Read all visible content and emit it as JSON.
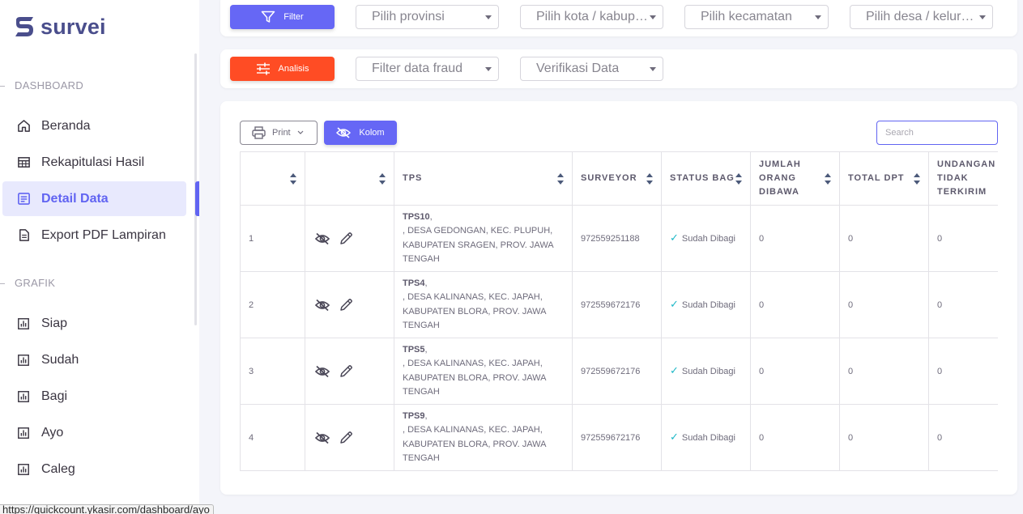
{
  "brand": {
    "name": "survei",
    "color": "#4a4e8c"
  },
  "accent": "#6164f2",
  "sidebar": {
    "sections": [
      {
        "title": "DASHBOARD"
      },
      {
        "title": "GRAFIK"
      }
    ],
    "items": [
      {
        "label": "Beranda",
        "icon": "home-icon"
      },
      {
        "label": "Rekapitulasi Hasil",
        "icon": "table-grid-icon"
      },
      {
        "label": "Detail Data",
        "icon": "document-list-icon",
        "active": true
      },
      {
        "label": "Export PDF Lampiran",
        "icon": "file-icon"
      },
      {
        "label": "Siap",
        "icon": "bar-chart-icon"
      },
      {
        "label": "Sudah",
        "icon": "bar-chart-icon"
      },
      {
        "label": "Bagi",
        "icon": "bar-chart-icon"
      },
      {
        "label": "Ayo",
        "icon": "bar-chart-icon"
      },
      {
        "label": "Caleg",
        "icon": "bar-chart-icon"
      }
    ]
  },
  "filters": {
    "filter_button": "Filter",
    "provinsi": "Pilih provinsi",
    "kota": "Pilih kota / kabupaten",
    "kecamatan": "Pilih kecamatan",
    "desa": "Pilih desa / kelurahan"
  },
  "analisis": {
    "button": "Analisis",
    "fraud": "Filter data fraud",
    "verifikasi": "Verifikasi Data"
  },
  "toolbar": {
    "print": "Print",
    "kolom": "Kolom",
    "search_placeholder": "Search"
  },
  "table": {
    "columns": [
      "",
      "",
      "TPS",
      "SURVEYOR",
      "STATUS BAGI",
      "JUMLAH ORANG DIBAWA",
      "TOTAL DPT",
      "UNDANGAN TIDAK TERKIRIM"
    ],
    "rows": [
      {
        "no": "1",
        "tps": "TPS10",
        "address": ", DESA GEDONGAN, KEC. PLUPUH, KABUPATEN SRAGEN, PROV. JAWA TENGAH",
        "surveyor": "972559251188",
        "status": "Sudah Dibagi",
        "jumlah": "0",
        "dpt": "0",
        "undangan": "0"
      },
      {
        "no": "2",
        "tps": "TPS4",
        "address": ", DESA KALINANAS, KEC. JAPAH, KABUPATEN BLORA, PROV. JAWA TENGAH",
        "surveyor": "972559672176",
        "status": "Sudah Dibagi",
        "jumlah": "0",
        "dpt": "0",
        "undangan": "0"
      },
      {
        "no": "3",
        "tps": "TPS5",
        "address": ", DESA KALINANAS, KEC. JAPAH, KABUPATEN BLORA, PROV. JAWA TENGAH",
        "surveyor": "972559672176",
        "status": "Sudah Dibagi",
        "jumlah": "0",
        "dpt": "0",
        "undangan": "0"
      },
      {
        "no": "4",
        "tps": "TPS9",
        "address": ", DESA KALINANAS, KEC. JAPAH, KABUPATEN BLORA, PROV. JAWA TENGAH",
        "surveyor": "972559672176",
        "status": "Sudah Dibagi",
        "jumlah": "0",
        "dpt": "0",
        "undangan": "0"
      }
    ]
  },
  "status_url": "https://quickcount.ykasir.com/dashboard/ayo"
}
